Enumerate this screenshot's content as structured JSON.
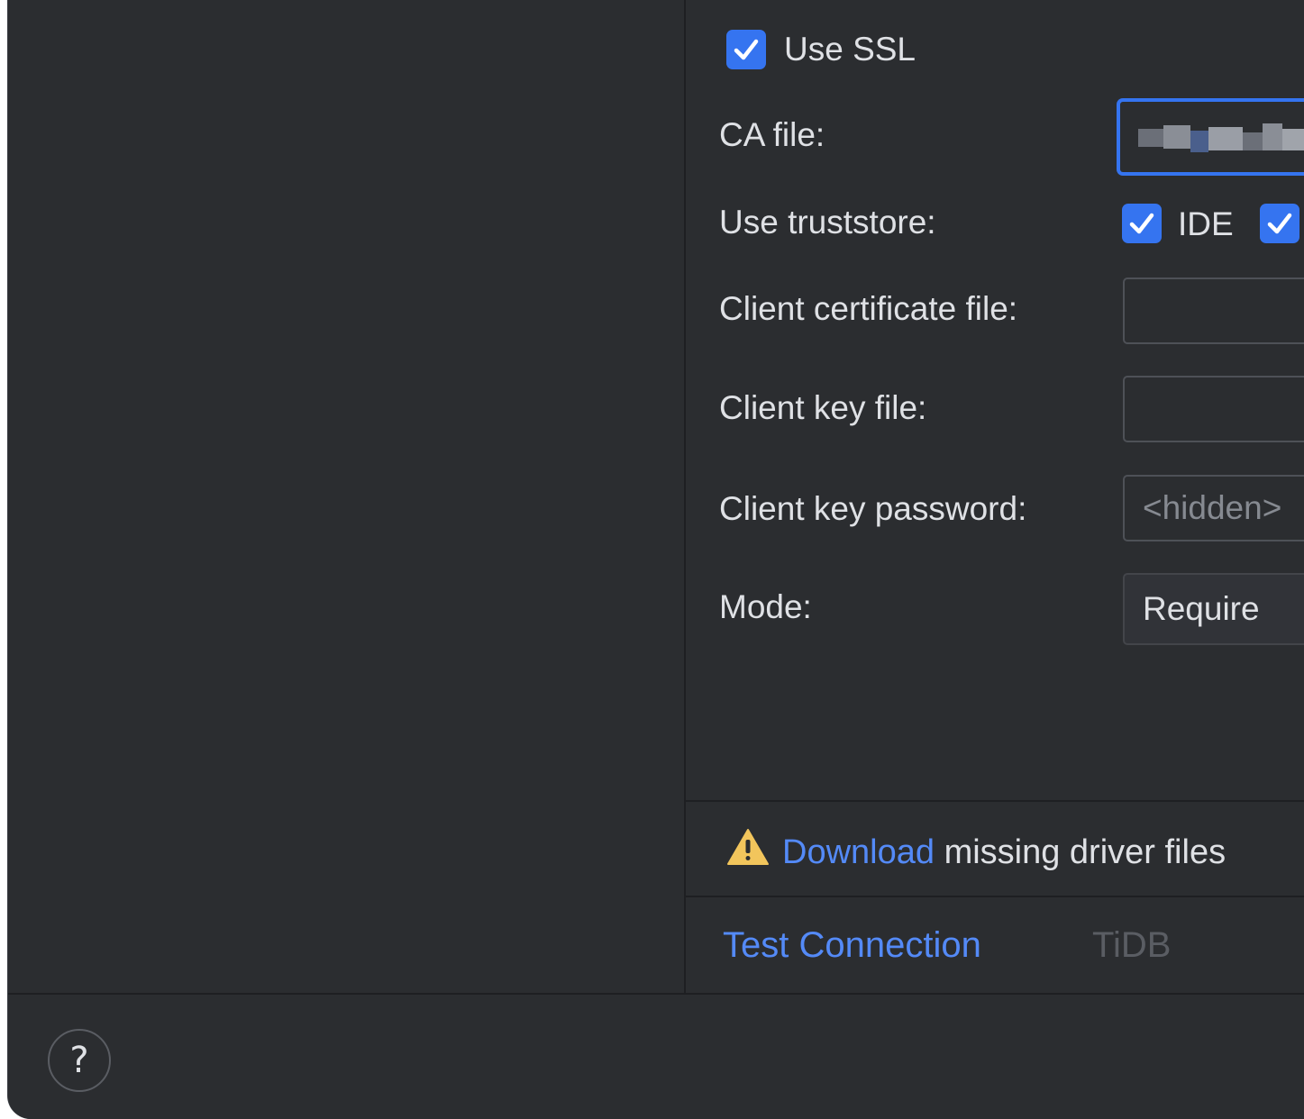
{
  "ssl": {
    "use_ssl_label": "Use SSL",
    "use_ssl_checked": true,
    "ca_file_label": "CA file:",
    "ca_file_value": "",
    "use_truststore_label": "Use truststore:",
    "truststore_ide_label": "IDE",
    "truststore_ide_checked": true,
    "truststore_second_checked": true,
    "client_cert_label": "Client certificate file:",
    "client_cert_value": "",
    "client_key_label": "Client key file:",
    "client_key_value": "",
    "client_key_password_label": "Client key password:",
    "client_key_password_placeholder": "<hidden>",
    "mode_label": "Mode:",
    "mode_value": "Require"
  },
  "warning": {
    "icon": "warning-icon",
    "link_text": "Download",
    "rest_text": "missing driver files"
  },
  "footer": {
    "test_connection_label": "Test Connection",
    "driver_name": "TiDB",
    "help_label": "?"
  },
  "colors": {
    "background": "#2b2d30",
    "accent": "#3574f0",
    "link": "#548af7",
    "warning": "#f2c55c"
  }
}
